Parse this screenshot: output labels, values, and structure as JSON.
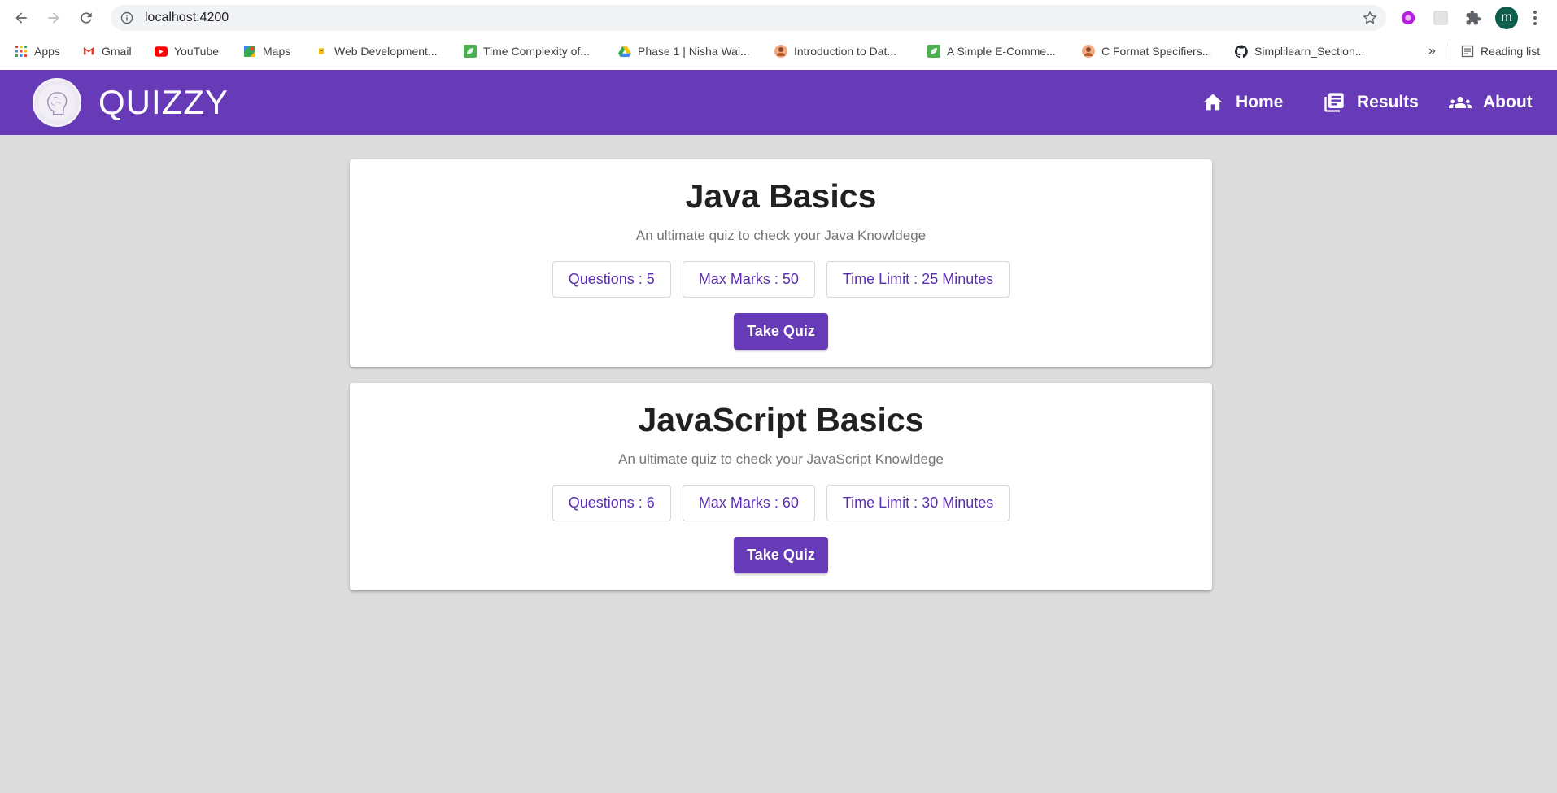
{
  "browser": {
    "url": "localhost:4200",
    "profile_initial": "m",
    "bookmarks": [
      {
        "label": "Apps",
        "icon": "apps-grid-icon"
      },
      {
        "label": "Gmail",
        "icon": "gmail-icon"
      },
      {
        "label": "YouTube",
        "icon": "youtube-icon"
      },
      {
        "label": "Maps",
        "icon": "maps-icon"
      },
      {
        "label": "Web Development...",
        "icon": "bookmark-icon"
      },
      {
        "label": "Time Complexity of...",
        "icon": "leaf-icon"
      },
      {
        "label": "Phase 1 | Nisha Wai...",
        "icon": "google-drive-icon"
      },
      {
        "label": "Introduction to Dat...",
        "icon": "profile-favicon-icon"
      },
      {
        "label": "A Simple E-Comme...",
        "icon": "leaf-icon"
      },
      {
        "label": "C Format Specifiers...",
        "icon": "profile-favicon-icon"
      },
      {
        "label": "Simplilearn_Section...",
        "icon": "github-icon"
      }
    ],
    "more_bookmarks": "»",
    "reading_list": "Reading list"
  },
  "header": {
    "brand": "QUIZZY",
    "nav": [
      {
        "label": "Home",
        "icon": "home-icon"
      },
      {
        "label": "Results",
        "icon": "library-books-icon"
      },
      {
        "label": "About",
        "icon": "people-icon"
      }
    ],
    "color": "#673ab7"
  },
  "quizzes": [
    {
      "title": "Java Basics",
      "description": "An ultimate quiz to check your Java Knowldege",
      "questions": "Questions : 5",
      "max_marks": "Max Marks : 50",
      "time_limit": "Time Limit : 25 Minutes",
      "action": "Take Quiz"
    },
    {
      "title": "JavaScript Basics",
      "description": "An ultimate quiz to check your JavaScript Knowldege",
      "questions": "Questions : 6",
      "max_marks": "Max Marks : 60",
      "time_limit": "Time Limit : 30 Minutes",
      "action": "Take Quiz"
    }
  ],
  "colors": {
    "accent": "#673ab7",
    "chip_text": "#5a2fb0",
    "background": "#dcdcdc"
  }
}
